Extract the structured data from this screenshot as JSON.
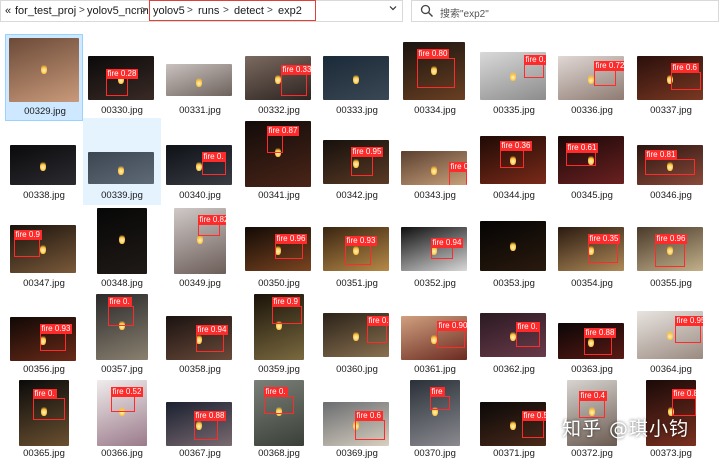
{
  "breadcrumb": {
    "prefix": "«",
    "items": [
      "for_test_proj",
      "yolov5_ncnn",
      "yolov5",
      "runs",
      "detect",
      "exp2"
    ],
    "separator": ">"
  },
  "search": {
    "placeholder": "搜索\"exp2\""
  },
  "watermark": "知乎 @琪小钧",
  "colors": {
    "selected": "#cde8ff",
    "hover": "#e5f3ff",
    "detection_box": "#ff2b2b",
    "highlight_box": "#e0403a"
  },
  "files": [
    {
      "name": "00329.jpg",
      "detections": []
    },
    {
      "name": "00330.jpg",
      "detections": [
        "fire 0.28"
      ]
    },
    {
      "name": "00331.jpg",
      "detections": []
    },
    {
      "name": "00332.jpg",
      "detections": [
        "fire 0.33"
      ]
    },
    {
      "name": "00333.jpg",
      "detections": []
    },
    {
      "name": "00334.jpg",
      "detections": [
        "fire 0.80"
      ]
    },
    {
      "name": "00335.jpg",
      "detections": [
        "fire 0."
      ]
    },
    {
      "name": "00336.jpg",
      "detections": [
        "fire 0.72"
      ]
    },
    {
      "name": "00337.jpg",
      "detections": [
        "fire 0.6"
      ]
    },
    {
      "name": "00338.jpg",
      "detections": []
    },
    {
      "name": "00339.jpg",
      "detections": []
    },
    {
      "name": "00340.jpg",
      "detections": [
        "fire 0."
      ]
    },
    {
      "name": "00341.jpg",
      "detections": [
        "fire 0.87"
      ]
    },
    {
      "name": "00342.jpg",
      "detections": [
        "fire 0.95"
      ]
    },
    {
      "name": "00343.jpg",
      "detections": [
        "fire 0.7"
      ]
    },
    {
      "name": "00344.jpg",
      "detections": [
        "fire 0.36"
      ]
    },
    {
      "name": "00345.jpg",
      "detections": [
        "fire 0.61"
      ]
    },
    {
      "name": "00346.jpg",
      "detections": [
        "fire 0.81"
      ]
    },
    {
      "name": "00347.jpg",
      "detections": [
        "fire 0.9"
      ]
    },
    {
      "name": "00348.jpg",
      "detections": []
    },
    {
      "name": "00349.jpg",
      "detections": [
        "fire 0.82"
      ]
    },
    {
      "name": "00350.jpg",
      "detections": [
        "fire 0.96"
      ]
    },
    {
      "name": "00351.jpg",
      "detections": [
        "fire 0.93"
      ]
    },
    {
      "name": "00352.jpg",
      "detections": [
        "fire 0.94"
      ]
    },
    {
      "name": "00353.jpg",
      "detections": []
    },
    {
      "name": "00354.jpg",
      "detections": [
        "fire 0.35"
      ]
    },
    {
      "name": "00355.jpg",
      "detections": [
        "fire 0.96"
      ]
    },
    {
      "name": "00356.jpg",
      "detections": [
        "fire 0.93"
      ]
    },
    {
      "name": "00357.jpg",
      "detections": [
        "fire 0."
      ]
    },
    {
      "name": "00358.jpg",
      "detections": [
        "fire 0.94"
      ]
    },
    {
      "name": "00359.jpg",
      "detections": [
        "fire 0.9"
      ]
    },
    {
      "name": "00360.jpg",
      "detections": [
        "fire 0.95"
      ]
    },
    {
      "name": "00361.jpg",
      "detections": [
        "fire 0.90"
      ]
    },
    {
      "name": "00362.jpg",
      "detections": [
        "fire 0."
      ]
    },
    {
      "name": "00363.jpg",
      "detections": [
        "fire 0.88"
      ]
    },
    {
      "name": "00364.jpg",
      "detections": [
        "fire 0.95"
      ]
    },
    {
      "name": "00365.jpg",
      "detections": [
        "fire 0."
      ]
    },
    {
      "name": "00366.jpg",
      "detections": [
        "fire 0.52"
      ]
    },
    {
      "name": "00367.jpg",
      "detections": [
        "fire 0.88"
      ]
    },
    {
      "name": "00368.jpg",
      "detections": [
        "fire 0."
      ]
    },
    {
      "name": "00369.jpg",
      "detections": [
        "fire 0.6"
      ]
    },
    {
      "name": "00370.jpg",
      "detections": [
        "fire"
      ]
    },
    {
      "name": "00371.jpg",
      "detections": [
        "fire 0.56"
      ]
    },
    {
      "name": "00372.jpg",
      "detections": [
        "fire 0.4"
      ]
    },
    {
      "name": "00373.jpg",
      "detections": [
        "fire 0.8"
      ]
    }
  ]
}
